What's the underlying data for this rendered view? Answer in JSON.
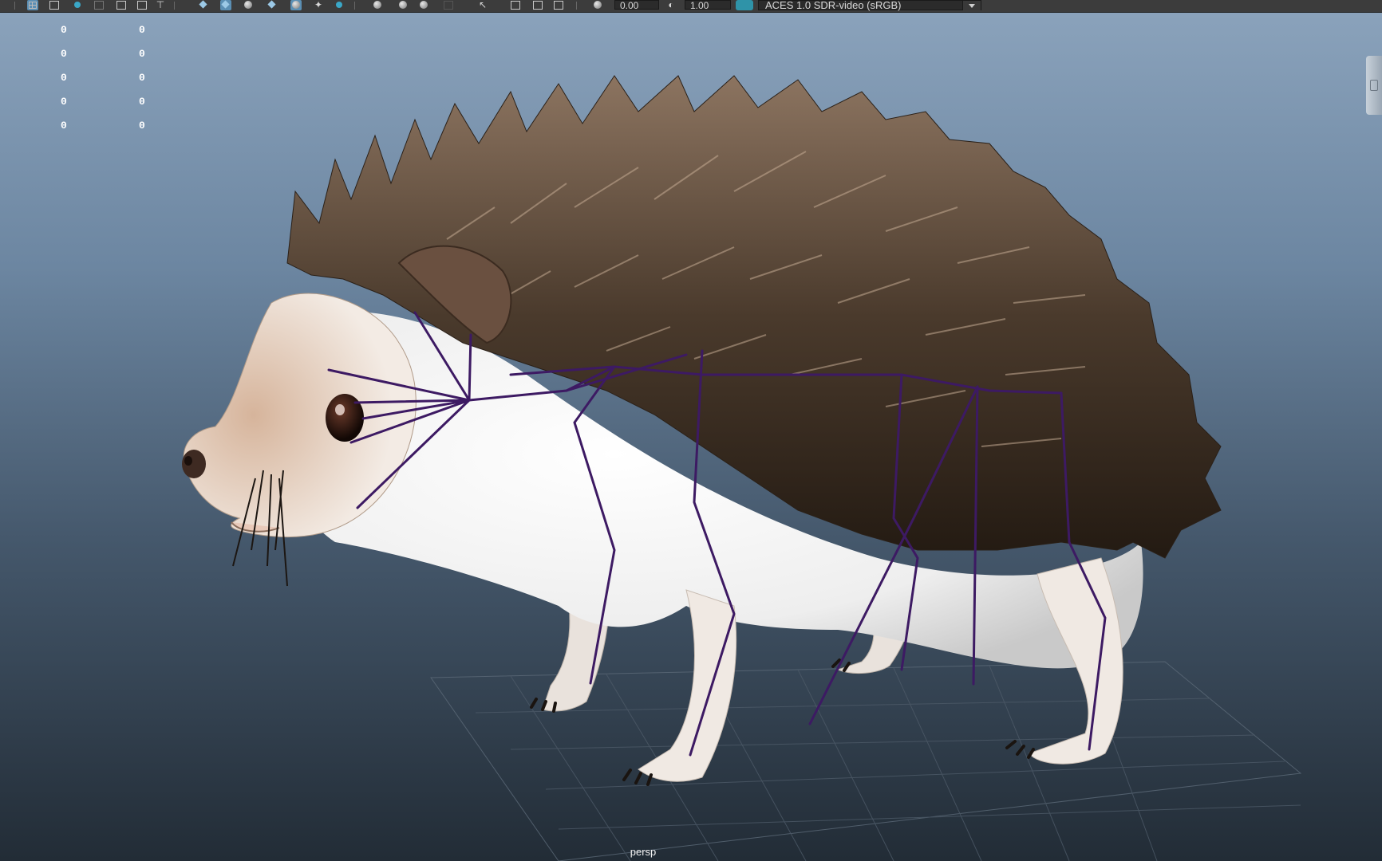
{
  "toolbar": {
    "icons": [
      "grid-icon",
      "image-plane-icon",
      "camera-icon",
      "safe-frame-icon",
      "resolution-gate-icon",
      "xray-icon",
      "smooth-shade-icon",
      "textured-icon",
      "lights-icon",
      "shadows-icon",
      "ambient-occlusion-icon",
      "motion-blur-icon",
      "antialias-icon",
      "depth-of-field-icon",
      "isolate-select-icon",
      "select-camera-icon",
      "wireframe-on-shaded-icon",
      "xray-joints-icon",
      "backface-icon"
    ],
    "exposure_value": "0.00",
    "gamma_value": "1.00",
    "color_space": "ACES 1.0 SDR-video (sRGB)"
  },
  "viewport": {
    "hud": {
      "rows": [
        [
          "0",
          "0"
        ],
        [
          "0",
          "0"
        ],
        [
          "0",
          "0"
        ],
        [
          "0",
          "0"
        ],
        [
          "0",
          "0"
        ]
      ]
    },
    "camera": "persp",
    "scene_subject": "hedgehog-3d-model",
    "rig_color": "#3d1a63",
    "background_top": "#8aa2bb",
    "background_bottom": "#222c36"
  }
}
